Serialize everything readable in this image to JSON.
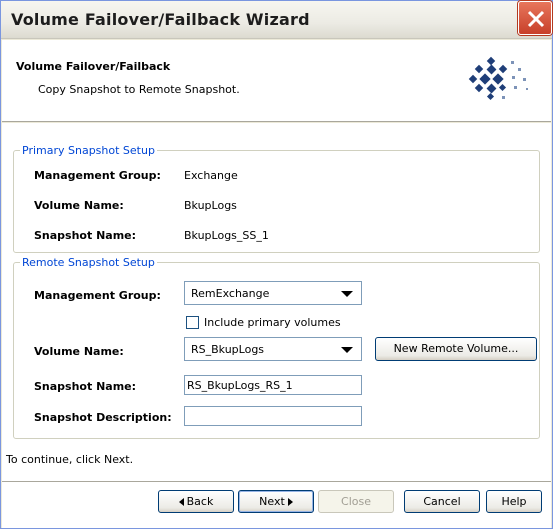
{
  "window": {
    "title": "Volume Failover/Failback Wizard"
  },
  "header": {
    "title": "Volume Failover/Failback",
    "subtitle": "Copy Snapshot to Remote Snapshot."
  },
  "primary": {
    "legend": "Primary Snapshot Setup",
    "mgmt_group_label": "Management Group:",
    "mgmt_group_value": "Exchange",
    "volume_label": "Volume Name:",
    "volume_value": "BkupLogs",
    "snapshot_label": "Snapshot Name:",
    "snapshot_value": "BkupLogs_SS_1"
  },
  "remote": {
    "legend": "Remote Snapshot Setup",
    "mgmt_group_label": "Management Group:",
    "mgmt_group_selected": "RemExchange",
    "include_primary_label": "Include primary volumes",
    "include_primary_checked": false,
    "volume_label": "Volume Name:",
    "volume_selected": "RS_BkupLogs",
    "new_volume_button": "New Remote Volume...",
    "snapshot_label": "Snapshot Name:",
    "snapshot_value": "RS_BkupLogs_RS_1",
    "description_label": "Snapshot Description:",
    "description_value": ""
  },
  "instructions": "To continue, click Next.",
  "footer": {
    "back_label": "Back",
    "next_label": "Next",
    "close_label": "Close",
    "cancel_label": "Cancel",
    "help_label": "Help"
  },
  "colors": {
    "legend_text": "#0046d5",
    "window_border": "#7a96df",
    "close_button": "#c8402a",
    "wizard_logo": "#1f3e78"
  }
}
